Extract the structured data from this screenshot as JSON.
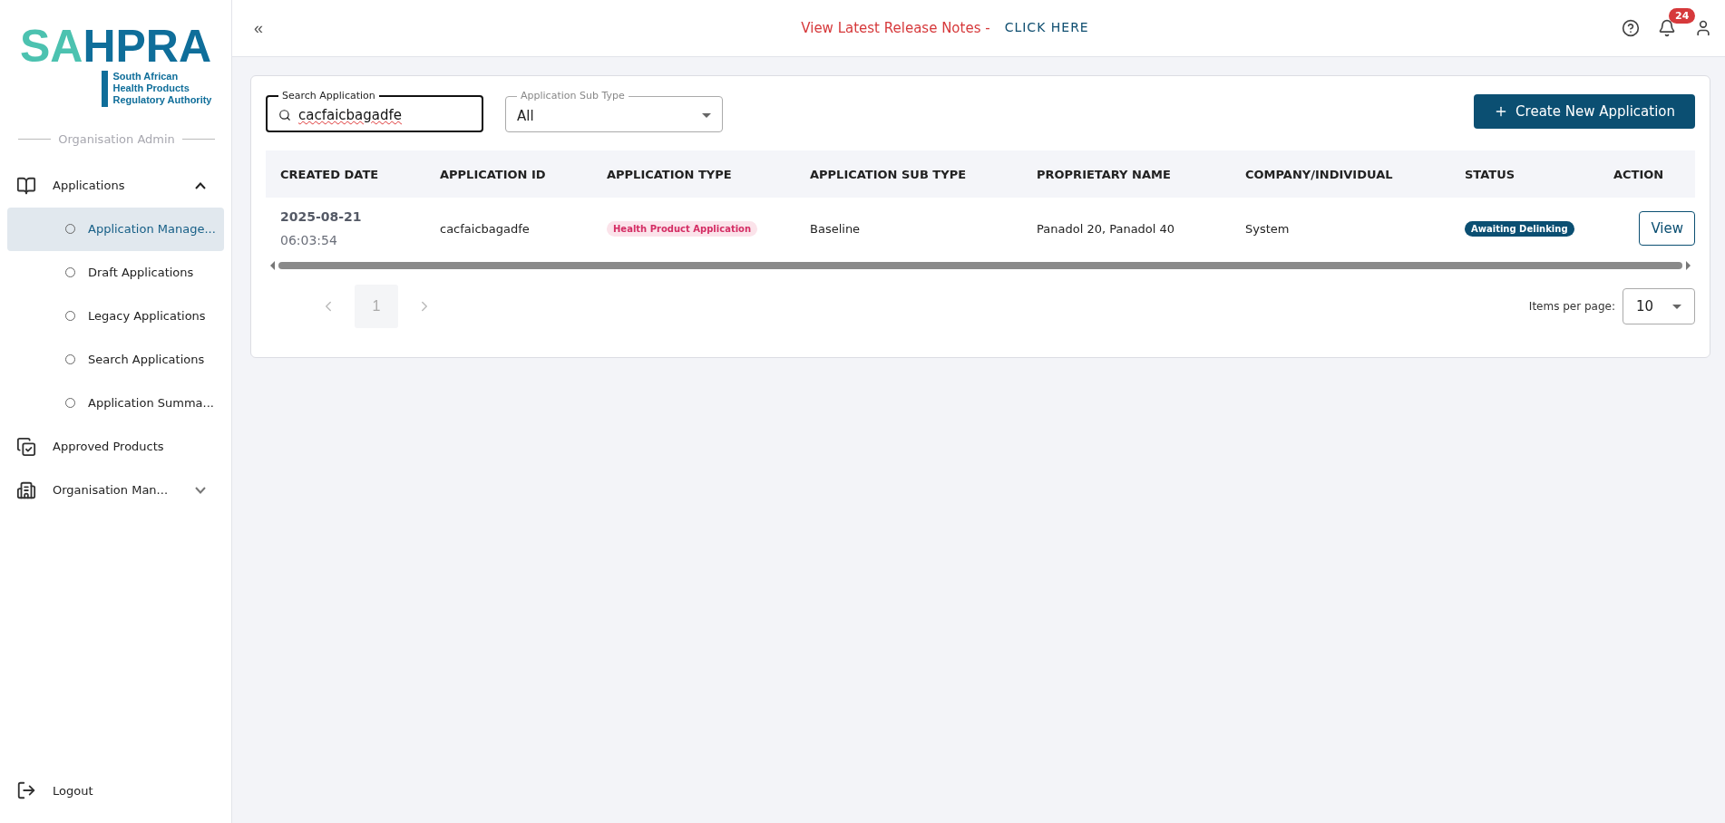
{
  "logo": {
    "part_1": "SA",
    "part_2": "HPRA",
    "subtitle": [
      "South African",
      "Health Products",
      "Regulatory Authority"
    ]
  },
  "role_label": "Organisation Admin",
  "sidebar": {
    "items": [
      {
        "label": "Applications",
        "kind": "book",
        "expanded": true,
        "children": [
          {
            "label": "Application Manage...",
            "selected": true
          },
          {
            "label": "Draft Applications",
            "selected": false
          },
          {
            "label": "Legacy Applications",
            "selected": false
          },
          {
            "label": "Search Applications",
            "selected": false
          },
          {
            "label": "Application Summa...",
            "selected": false
          }
        ]
      },
      {
        "label": "Approved Products",
        "kind": "checks"
      },
      {
        "label": "Organisation Man...",
        "kind": "building",
        "expanded": false
      }
    ],
    "logout": "Logout"
  },
  "header": {
    "collapse": "«",
    "notice": "View Latest Release Notes -",
    "link": "CLICK HERE",
    "notification_count": "24"
  },
  "filters": {
    "search": {
      "label": "Search Application",
      "value": "cacfaicbagadfe"
    },
    "sub_type": {
      "label": "Application Sub Type",
      "value": "All"
    },
    "create_button": "Create New Application"
  },
  "table": {
    "columns": [
      "CREATED DATE",
      "APPLICATION ID",
      "APPLICATION TYPE",
      "APPLICATION SUB TYPE",
      "PROPRIETARY NAME",
      "COMPANY/INDIVIDUAL",
      "STATUS",
      "ACTION"
    ],
    "rows": [
      {
        "date": "2025-08-21",
        "time": "06:03:54",
        "id": "cacfaicbagadfe",
        "type": "Health Product Application",
        "sub_type": "Baseline",
        "proprietary_name": "Panadol 20, Panadol 40",
        "company": "System",
        "status": "Awaiting Delinking",
        "action": "View"
      }
    ]
  },
  "pagination": {
    "page": "1",
    "items_per_page_label": "Items per page:",
    "items_per_page": "10"
  }
}
